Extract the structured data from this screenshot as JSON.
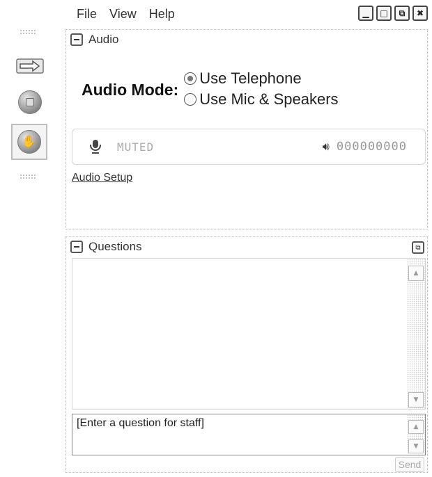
{
  "menu": {
    "items": [
      {
        "label": "File"
      },
      {
        "label": "View"
      },
      {
        "label": "Help"
      }
    ]
  },
  "window_controls": [
    "minimize-icon",
    "maximize-icon",
    "restore-icon",
    "close-icon"
  ],
  "toolbar": {
    "buttons": [
      "arrow-icon",
      "stop-icon",
      "raise-hand-icon"
    ],
    "selected": "raise-hand-icon"
  },
  "audio_panel": {
    "title": "Audio",
    "mode_label": "Audio Mode:",
    "options": [
      {
        "label": "Use Telephone",
        "checked": true
      },
      {
        "label": "Use Mic & Speakers",
        "checked": false
      }
    ],
    "status": {
      "mic_state": "MUTED",
      "level": "000000000"
    },
    "setup_link": "Audio Setup"
  },
  "questions_panel": {
    "title": "Questions",
    "input_placeholder": "[Enter a question for staff]",
    "send_label": "Send"
  }
}
